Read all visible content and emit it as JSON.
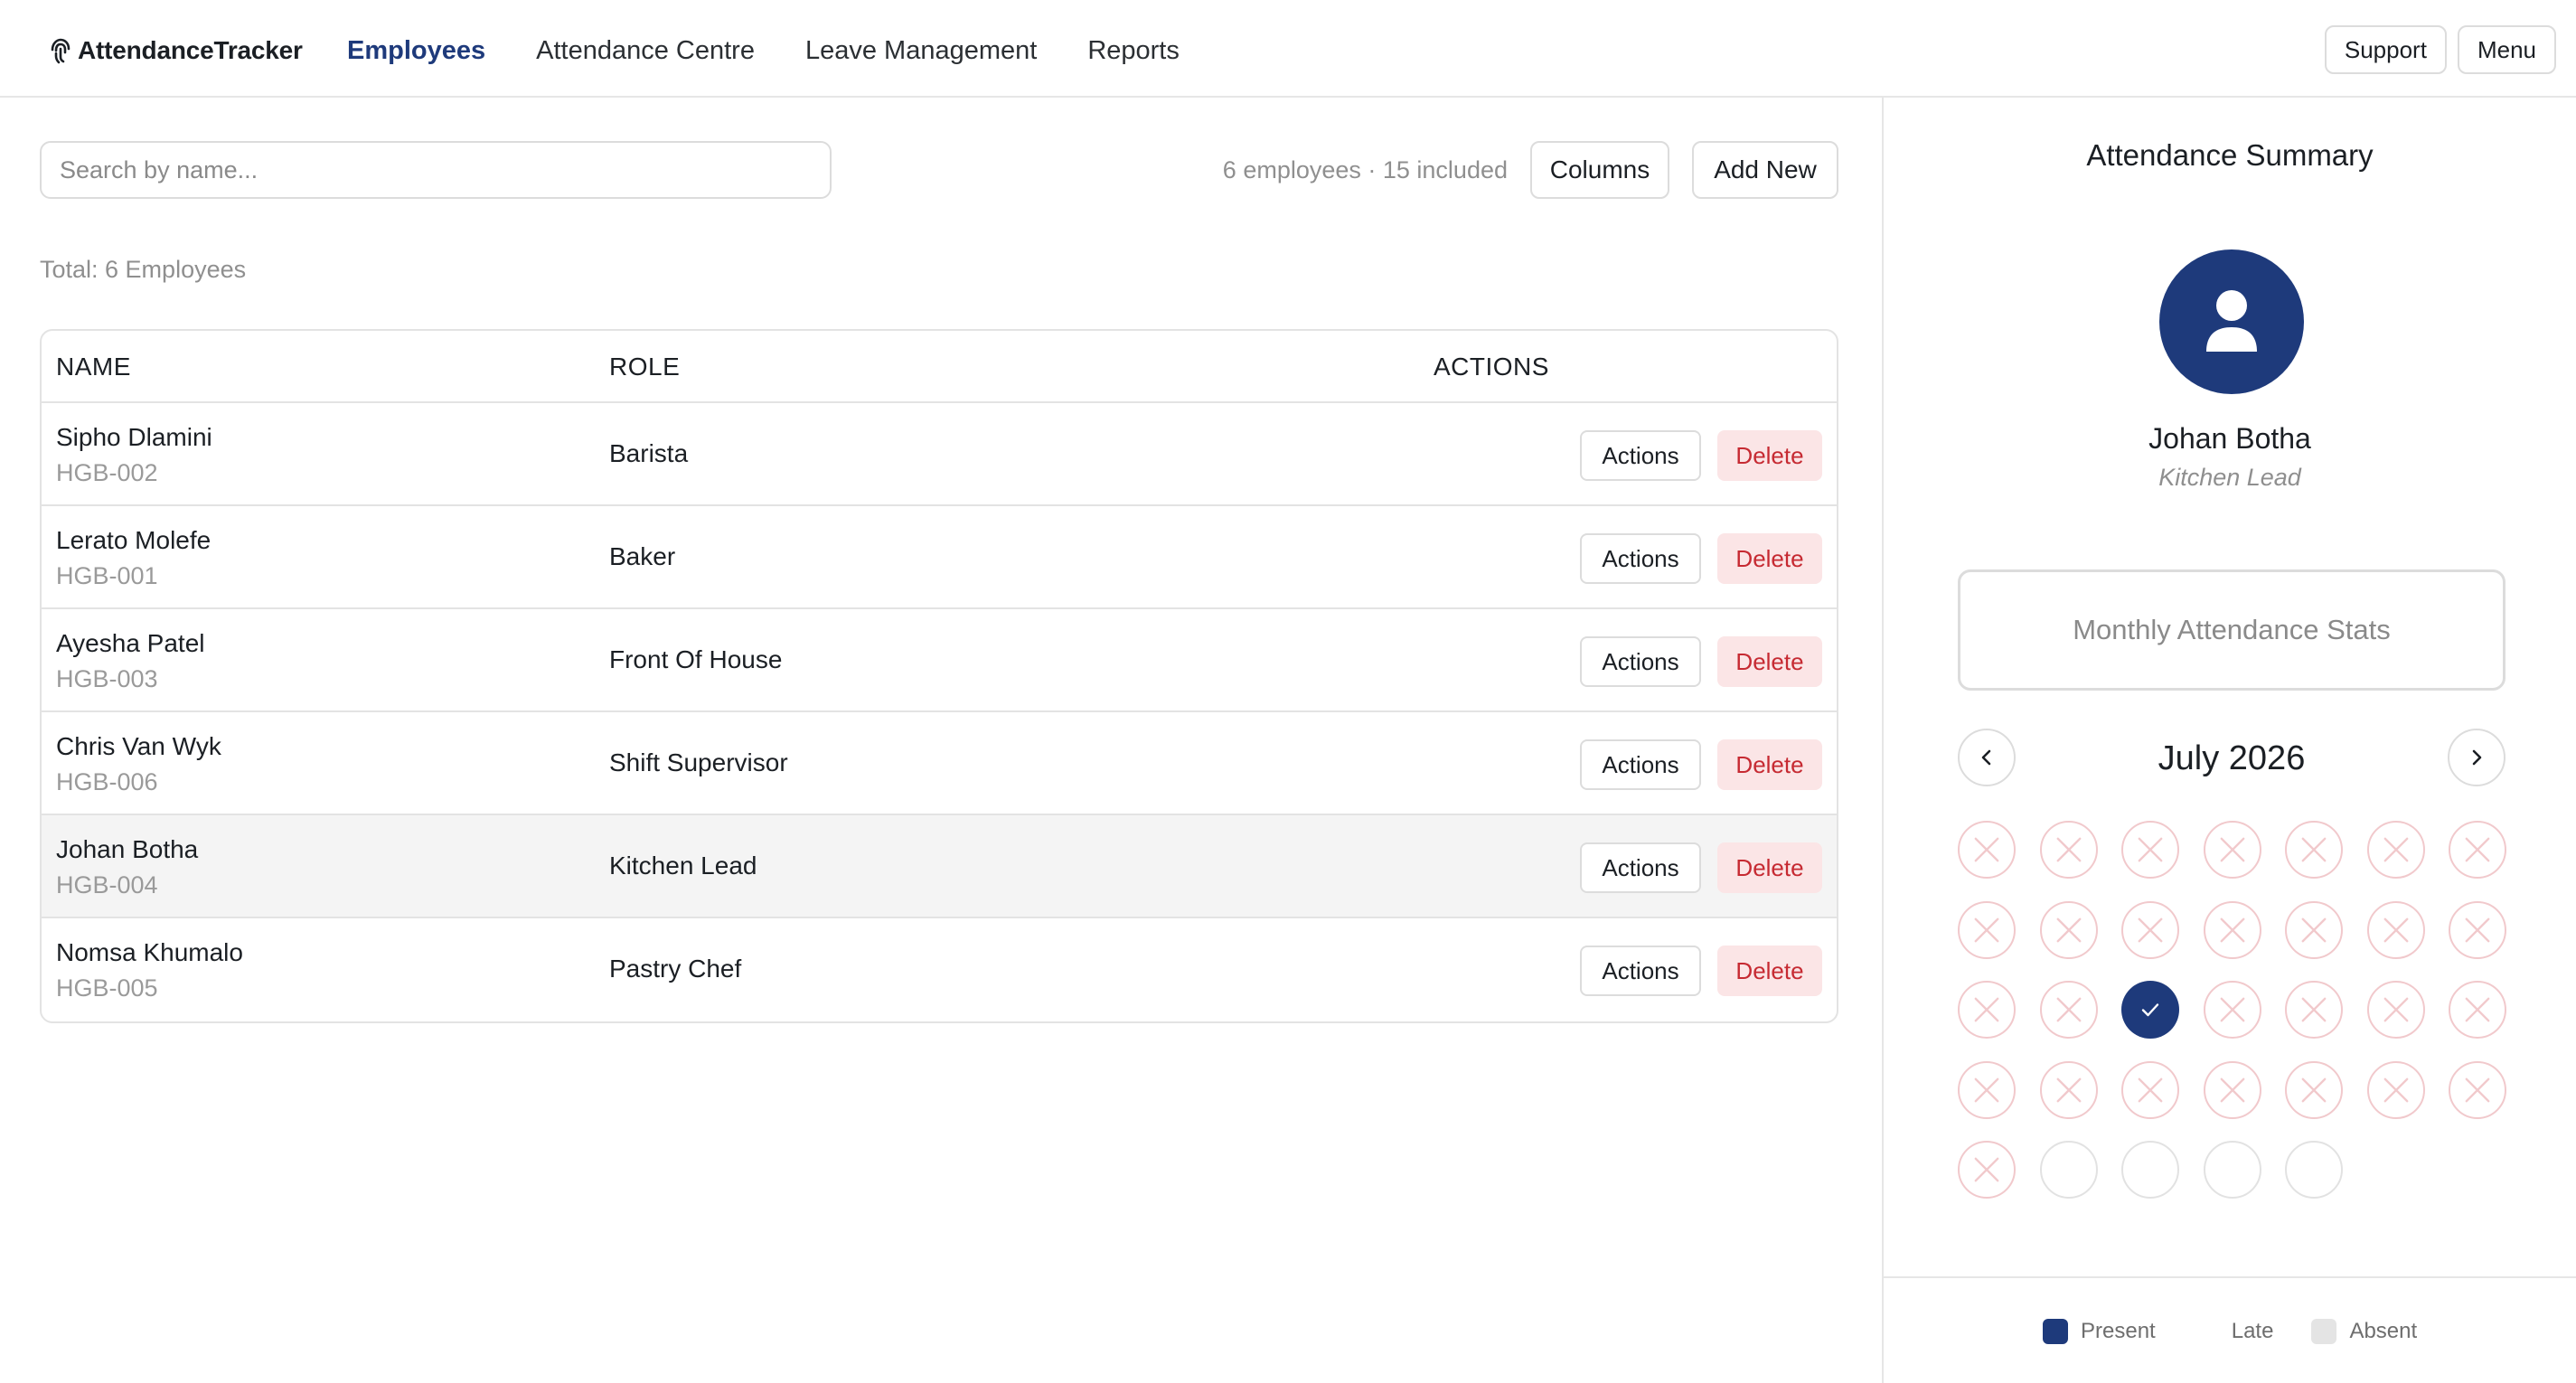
{
  "app": {
    "brand": "AttendanceTracker"
  },
  "nav": {
    "items": [
      "Employees",
      "Attendance Centre",
      "Leave Management",
      "Reports"
    ],
    "active": "Employees",
    "support_label": "Support",
    "menu_label": "Menu"
  },
  "toolbar": {
    "search_placeholder": "Search by name...",
    "count_text": "6 employees · 15 included",
    "columns_label": "Columns",
    "add_new_label": "Add New",
    "total_text": "Total: 6 Employees"
  },
  "table": {
    "headers": {
      "name": "NAME",
      "role": "ROLE",
      "actions": "ACTIONS"
    },
    "action_label": "Actions",
    "delete_label": "Delete",
    "rows": [
      {
        "name": "Sipho Dlamini",
        "id": "HGB-002",
        "role": "Barista",
        "selected": false
      },
      {
        "name": "Lerato Molefe",
        "id": "HGB-001",
        "role": "Baker",
        "selected": false
      },
      {
        "name": "Ayesha Patel",
        "id": "HGB-003",
        "role": "Front Of House",
        "selected": false
      },
      {
        "name": "Chris Van Wyk",
        "id": "HGB-006",
        "role": "Shift Supervisor",
        "selected": false
      },
      {
        "name": "Johan Botha",
        "id": "HGB-004",
        "role": "Kitchen Lead",
        "selected": true
      },
      {
        "name": "Nomsa Khumalo",
        "id": "HGB-005",
        "role": "Pastry Chef",
        "selected": false
      }
    ]
  },
  "summary": {
    "title": "Attendance Summary",
    "employee_name": "Johan Botha",
    "employee_role": "Kitchen Lead",
    "stats_button": "Monthly Attendance Stats",
    "month": "July 2026",
    "days": [
      "absent",
      "absent",
      "absent",
      "absent",
      "absent",
      "absent",
      "absent",
      "absent",
      "absent",
      "absent",
      "absent",
      "absent",
      "absent",
      "absent",
      "absent",
      "absent",
      "present",
      "absent",
      "absent",
      "absent",
      "absent",
      "absent",
      "absent",
      "absent",
      "absent",
      "absent",
      "absent",
      "absent",
      "absent",
      "empty",
      "empty",
      "empty",
      "empty"
    ],
    "legend": [
      {
        "label": "Present",
        "color": "#1e3a7b"
      },
      {
        "label": "Late",
        "color": "#ffffff"
      },
      {
        "label": "Absent",
        "color": "#e4e4e4"
      }
    ]
  },
  "colors": {
    "accent": "#1e3a7b",
    "delete_bg": "#fbe5e6",
    "delete_text": "#c62a32",
    "absent_ring": "#f1c9cc"
  }
}
